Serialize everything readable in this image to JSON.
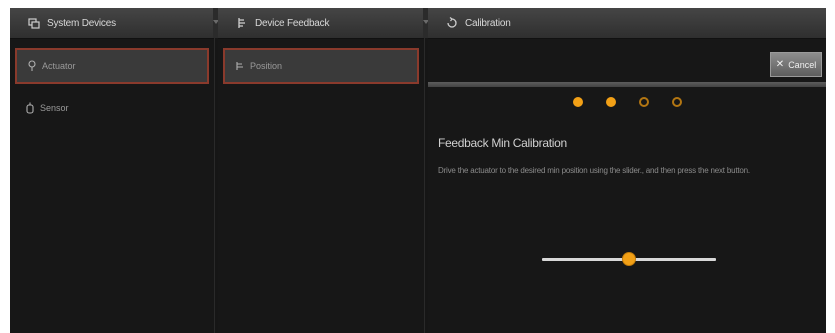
{
  "panels": {
    "system_devices": {
      "title": "System Devices",
      "items": [
        {
          "label": "Actuator",
          "icon": "actuator-icon",
          "selected": true
        },
        {
          "label": "Sensor",
          "icon": "sensor-icon",
          "selected": false
        }
      ]
    },
    "device_feedback": {
      "title": "Device Feedback",
      "items": [
        {
          "label": "Position",
          "icon": "position-icon",
          "selected": true
        }
      ]
    },
    "calibration": {
      "title": "Calibration",
      "cancel_label": "Cancel",
      "steps": [
        {
          "state": "completed"
        },
        {
          "state": "completed"
        },
        {
          "state": "pending"
        },
        {
          "state": "pending"
        }
      ],
      "heading": "Feedback Min Calibration",
      "instructions": "Drive the actuator to the desired min position using the slider., and then press the next button.",
      "slider_value": 0.5
    }
  },
  "colors": {
    "accent": "#f2a016",
    "selection_border": "#8a3a2c",
    "header_bg": "#3a3a3a",
    "panel_bg": "#171717"
  }
}
